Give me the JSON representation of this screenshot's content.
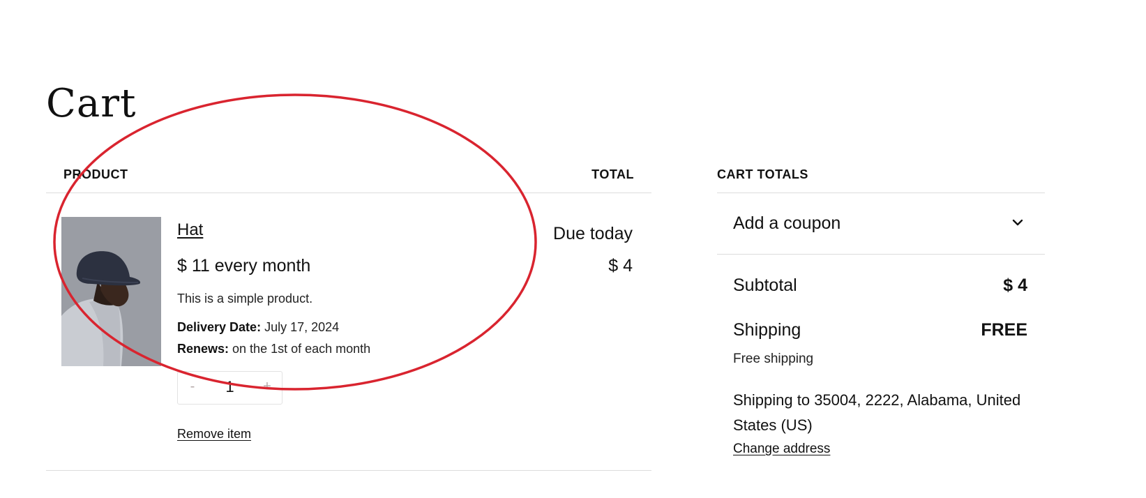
{
  "page": {
    "title": "Cart"
  },
  "cart_table": {
    "col_product": "PRODUCT",
    "col_total": "TOTAL",
    "items": [
      {
        "name": "Hat",
        "price": "$ 11 every month",
        "description": "This is a simple product.",
        "delivery_label": "Delivery Date:",
        "delivery_value": " July 17, 2024",
        "renews_label": "Renews:",
        "renews_value": " on the 1st of each month",
        "qty_minus": "-",
        "quantity": "1",
        "qty_plus": "+",
        "remove_label": "Remove item",
        "due_label": "Due today",
        "due_amount": "$ 4",
        "image_icon": "product-photo-hat"
      }
    ]
  },
  "totals": {
    "title": "CART TOTALS",
    "coupon_label": "Add a coupon",
    "coupon_icon": "chevron-down-icon",
    "subtotal_label": "Subtotal",
    "subtotal_value": "$ 4",
    "shipping_label": "Shipping",
    "shipping_value": "FREE",
    "shipping_method": "Free shipping",
    "shipping_address": "Shipping to 35004, 2222, Alabama, United States (US)",
    "change_address_label": "Change address"
  },
  "colors": {
    "annotation_ellipse": "#d9242f",
    "divider": "#dcdcdc",
    "stepper_glyph": "#b5a9a9"
  }
}
